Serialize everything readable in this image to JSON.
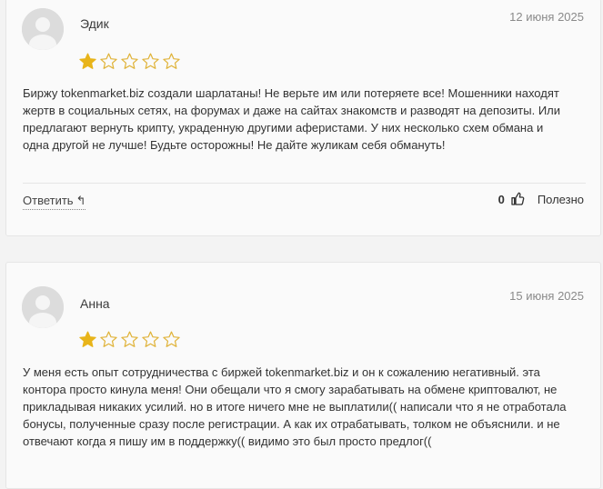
{
  "reviews": [
    {
      "author": "Эдик",
      "date": "12 июня 2025",
      "rating": 1,
      "max_rating": 5,
      "text": "Биржу tokenmarket.biz создали шарлатаны! Не верьте им или потеряете все! Мошенники находят жертв в социальных сетях, на форумах и даже на сайтах знакомств и разводят на депозиты. Или предлагают вернуть крипту, украденную другими аферистами. У них несколько схем обмана и одна другой не лучше! Будьте осторожны! Не дайте жуликам себя обмануть!",
      "reply_label": "Ответить",
      "likes": "0",
      "useful_label": "Полезно"
    },
    {
      "author": "Анна",
      "date": "15 июня 2025",
      "rating": 1,
      "max_rating": 5,
      "text": "У меня есть опыт сотрудничества с биржей tokenmarket.biz и он к сожалению негативный. эта контора просто кинула меня! Они обещали что я смогу зарабатывать на обмене криптовалют, не прикладывая никаких усилий. но в итоге ничего мне не выплатили(( написали что я не отработала бонусы, полученные сразу после регистрации. А как их отрабатывать, толком не объяснили. и не отвечают когда я пишу им в поддержку(( видимо это был просто предлог(("
    }
  ],
  "colors": {
    "star_filled": "#e8b41a",
    "star_empty_stroke": "#e0b33a",
    "card_bg": "#fafafa",
    "page_bg": "#f3f3f3"
  }
}
